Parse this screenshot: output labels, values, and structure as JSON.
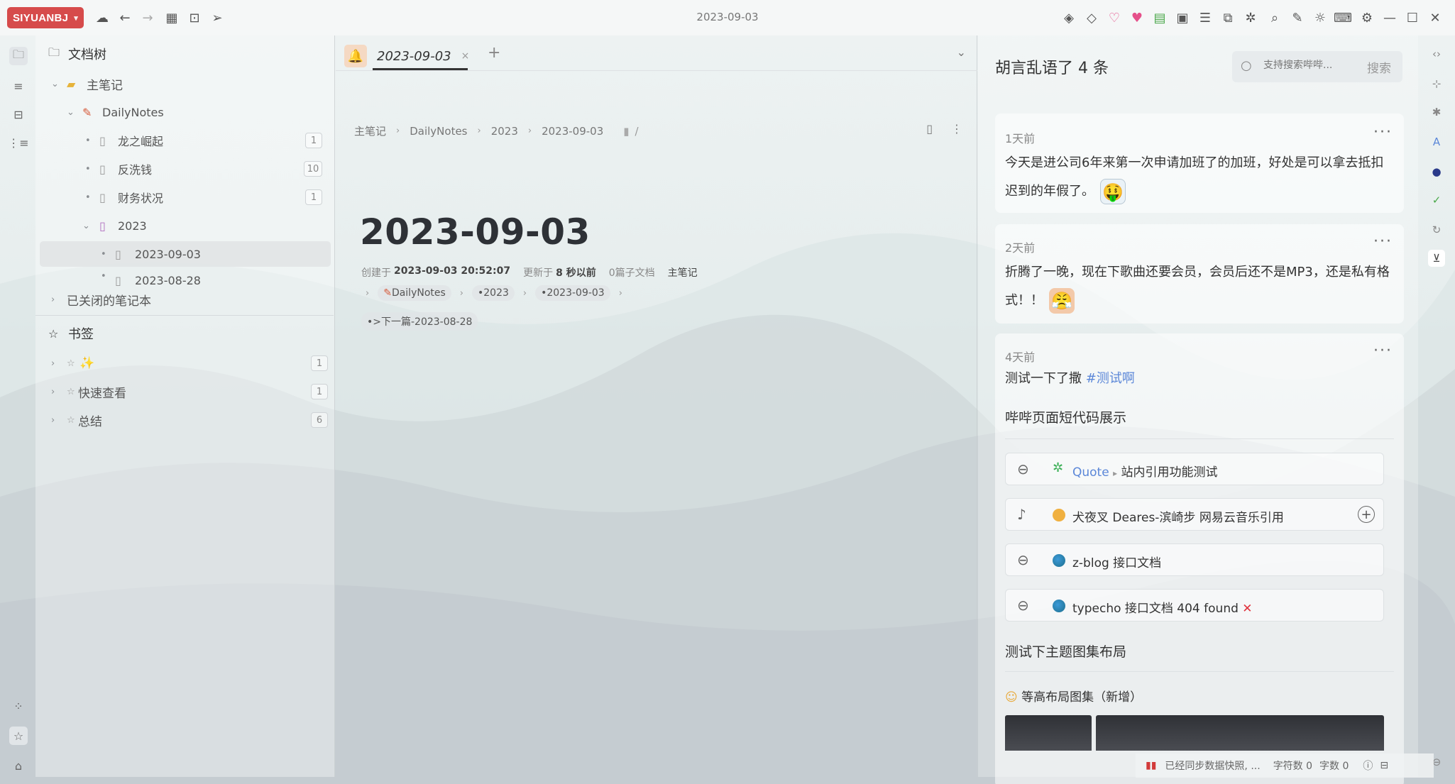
{
  "app": {
    "brand": "SIYUANBJ",
    "window_title": "2023-09-03"
  },
  "filetree": {
    "header": "文档树",
    "notebook": "主笔记",
    "items": [
      {
        "label": "DailyNotes",
        "icon": "pencil-icon"
      },
      {
        "label": "龙之崛起",
        "count": "1"
      },
      {
        "label": "反洗钱",
        "count": "10"
      },
      {
        "label": "财务状况",
        "count": "1"
      },
      {
        "label": "2023"
      },
      {
        "label": "2023-09-03"
      },
      {
        "label": "2023-08-28"
      }
    ],
    "closed_notebooks": "已关闭的笔记本",
    "bookmarks_header": "书签",
    "bookmarks": [
      {
        "label": "✨",
        "count": "1"
      },
      {
        "label": "快速查看",
        "count": "1"
      },
      {
        "label": "总结",
        "count": "6"
      }
    ]
  },
  "editor": {
    "tab_label": "2023-09-03",
    "breadcrumb": [
      "主笔记",
      "DailyNotes",
      "2023",
      "2023-09-03"
    ],
    "breadcrumb_slash": "/",
    "title": "2023-09-03",
    "meta": {
      "created_label": "创建于",
      "created_value": "2023-09-03 20:52:07",
      "updated_label": "更新于",
      "updated_value": "8 秒以前",
      "subdocs": "0篇子文档",
      "notebook": "主笔记"
    },
    "chips": [
      "DailyNotes",
      "•2023",
      "•2023-09-03"
    ],
    "prev_chip": "•>下一篇-2023-08-28"
  },
  "panel": {
    "title": "胡言乱语了 4 条",
    "search_placeholder": "支持搜索哔哔...",
    "search_button": "搜索",
    "cards": [
      {
        "time": "1天前",
        "text": "今天是进公司6年来第一次申请加班了的加班，好处是可以拿去抵扣迟到的年假了。"
      },
      {
        "time": "2天前",
        "text": "折腾了一晚，现在下歌曲还要会员，会员后还不是MP3，还是私有格式！！"
      },
      {
        "time": "4天前",
        "text_prefix": "测试一下了撒 ",
        "tag": "#测试啊"
      }
    ],
    "section1": "哔哔页面短代码展示",
    "links": [
      {
        "quote": "Quote",
        "arrow": "▸",
        "text": "站内引用功能测试"
      },
      {
        "text": "犬夜叉 Deares-滨崎步 网易云音乐引用"
      },
      {
        "text": "z-blog 接口文档"
      },
      {
        "text": "typecho 接口文档 404 found"
      }
    ],
    "section2": "测试下主题图集布局",
    "gallery_label": "等高布局图集（新增）"
  },
  "status": {
    "sync": "已经同步数据快照, ...",
    "chars": "字符数 0",
    "words": "字数 0"
  },
  "colors": {
    "brand": "#d64b4b",
    "accent": "#5b87d8",
    "error": "#e0323c"
  }
}
